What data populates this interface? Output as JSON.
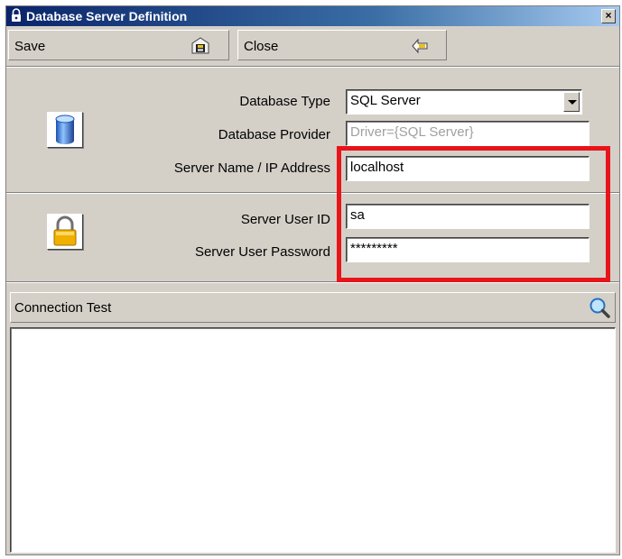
{
  "window": {
    "title": "Database Server Definition",
    "close_glyph": "×"
  },
  "toolbar": {
    "save_label": "Save",
    "close_label": "Close",
    "save_icon": "save-disk-icon",
    "close_icon": "exit-arrow-icon"
  },
  "database": {
    "icon": "database-cylinder-icon",
    "type_label": "Database Type",
    "type_value": "SQL Server",
    "provider_label": "Database Provider",
    "provider_value": "Driver={SQL Server}",
    "server_label": "Server Name / IP Address",
    "server_value": "localhost"
  },
  "credentials": {
    "icon": "padlock-icon",
    "user_label": "Server User ID",
    "user_value": "sa",
    "password_label": "Server User Password",
    "password_value": "*********"
  },
  "connection_test": {
    "label": "Connection Test",
    "icon": "magnifier-icon",
    "output": ""
  },
  "colors": {
    "highlight": "#e8141a",
    "title_bar": "#0a246a",
    "window_face": "#d4d0c8"
  }
}
